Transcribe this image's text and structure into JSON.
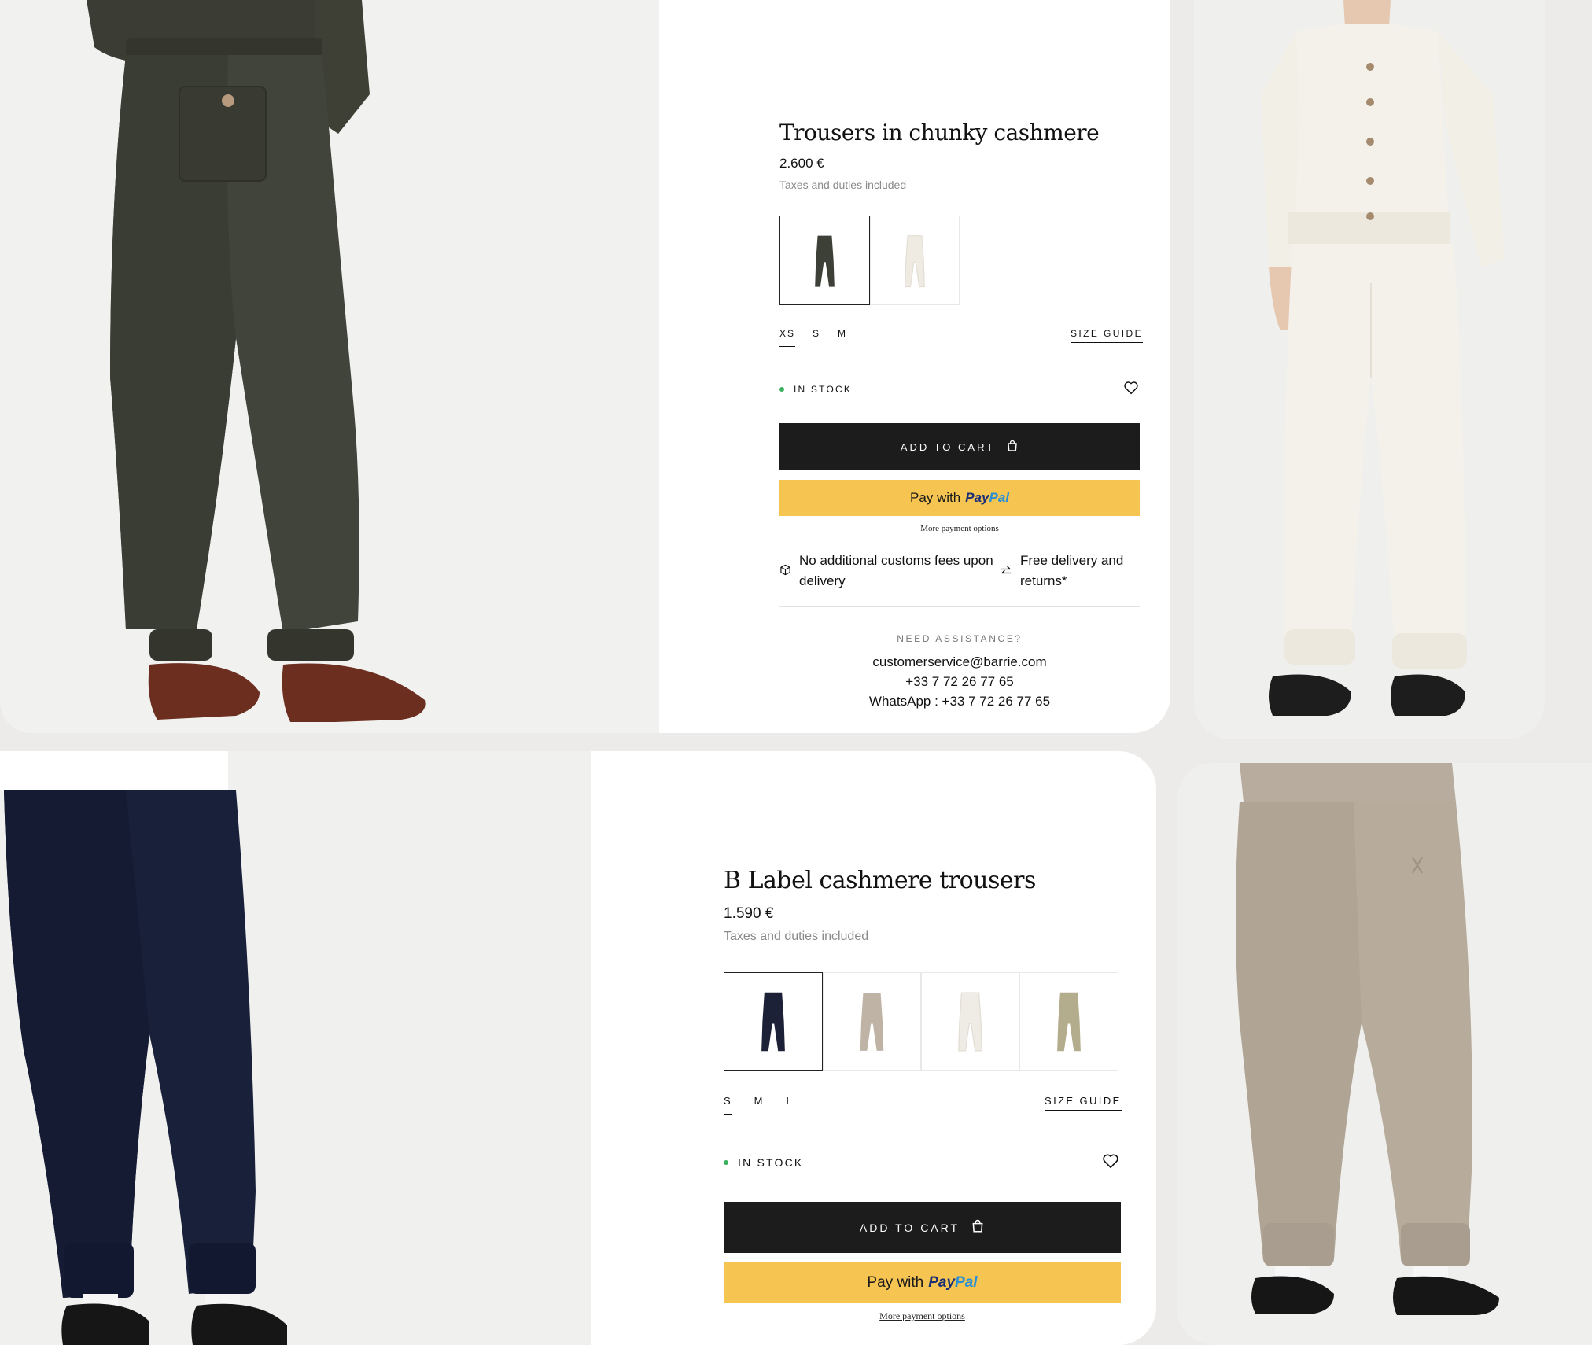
{
  "product1": {
    "title": "Trousers in chunky cashmere",
    "price": "2.600 €",
    "tax_note": "Taxes and duties included",
    "swatches": [
      {
        "name": "dark-green",
        "color": "#3d4037"
      },
      {
        "name": "ivory",
        "color": "#efebe3"
      }
    ],
    "sizes": [
      "XS",
      "S",
      "M"
    ],
    "selected_size": "XS",
    "size_guide": "SIZE GUIDE",
    "stock": "IN STOCK",
    "add_to_cart": "ADD TO CART",
    "paypal_prefix": "Pay with",
    "paypal_pay": "Pay",
    "paypal_pal": "Pal",
    "more_payment": "More payment options",
    "feature_customs": "No additional customs fees upon delivery",
    "feature_delivery": "Free delivery and returns*",
    "assistance_title": "NEED ASSISTANCE?",
    "assistance_email": "customerservice@barrie.com",
    "assistance_phone": "+33 7 72 26 77 65",
    "assistance_whatsapp": "WhatsApp : +33 7 72 26 77 65"
  },
  "product2": {
    "title": "B Label cashmere trousers",
    "price": "1.590 €",
    "tax_note": "Taxes and duties included",
    "swatches": [
      {
        "name": "navy",
        "color": "#1c2138"
      },
      {
        "name": "taupe",
        "color": "#bfb3a6"
      },
      {
        "name": "ivory",
        "color": "#efebe5"
      },
      {
        "name": "khaki",
        "color": "#b4ad8d"
      }
    ],
    "sizes": [
      "S",
      "M",
      "L"
    ],
    "selected_size": "S",
    "size_guide": "SIZE GUIDE",
    "stock": "IN STOCK",
    "add_to_cart": "ADD TO CART",
    "paypal_prefix": "Pay with",
    "paypal_pay": "Pay",
    "paypal_pal": "Pal",
    "more_payment": "More payment options"
  },
  "colors": {
    "stock_green": "#38b05c",
    "cart_button": "#1c1c1c",
    "paypal_yellow": "#f5c451"
  }
}
